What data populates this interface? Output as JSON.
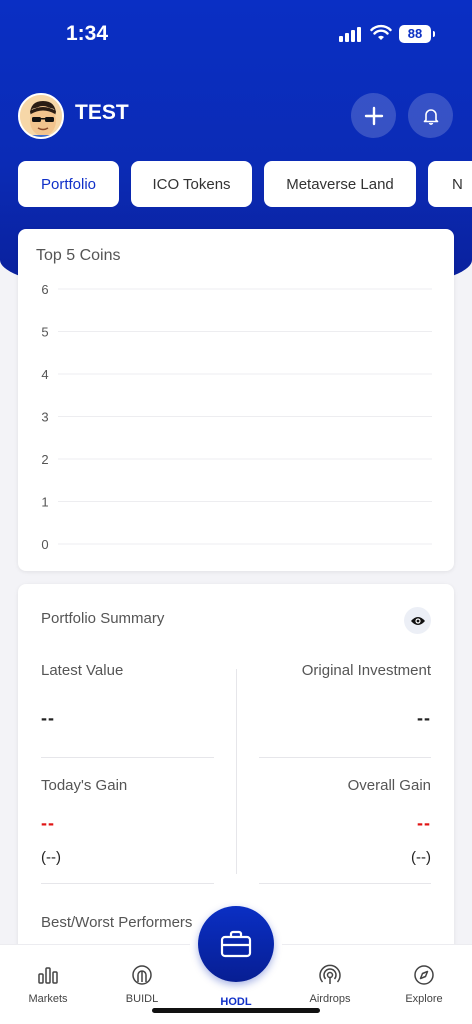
{
  "status": {
    "time": "1:34",
    "battery": "88"
  },
  "header": {
    "username": "TEST"
  },
  "tabs": [
    {
      "label": "Portfolio",
      "active": true
    },
    {
      "label": "ICO Tokens",
      "active": false
    },
    {
      "label": "Metaverse Land",
      "active": false
    },
    {
      "label": "N",
      "active": false
    }
  ],
  "chart_data": {
    "type": "bar",
    "title": "Top 5 Coins",
    "categories": [],
    "values": [],
    "ylim": [
      0,
      6
    ],
    "yticks": [
      "0",
      "1",
      "2",
      "3",
      "4",
      "5",
      "6"
    ],
    "grid": true
  },
  "summary": {
    "title": "Portfolio Summary",
    "latest_value_label": "Latest Value",
    "latest_value": "--",
    "original_investment_label": "Original Investment",
    "original_investment": "--",
    "todays_gain_label": "Today's Gain",
    "todays_gain": "--",
    "todays_gain_pct": "(--)",
    "overall_gain_label": "Overall Gain",
    "overall_gain": "--",
    "overall_gain_pct": "(--)",
    "best_worst_label": "Best/Worst Performers"
  },
  "nav": {
    "markets": "Markets",
    "buidl": "BUIDL",
    "hodl": "HODL",
    "airdrops": "Airdrops",
    "explore": "Explore"
  },
  "colors": {
    "primary": "#0a2fc4",
    "loss": "#e01414"
  }
}
